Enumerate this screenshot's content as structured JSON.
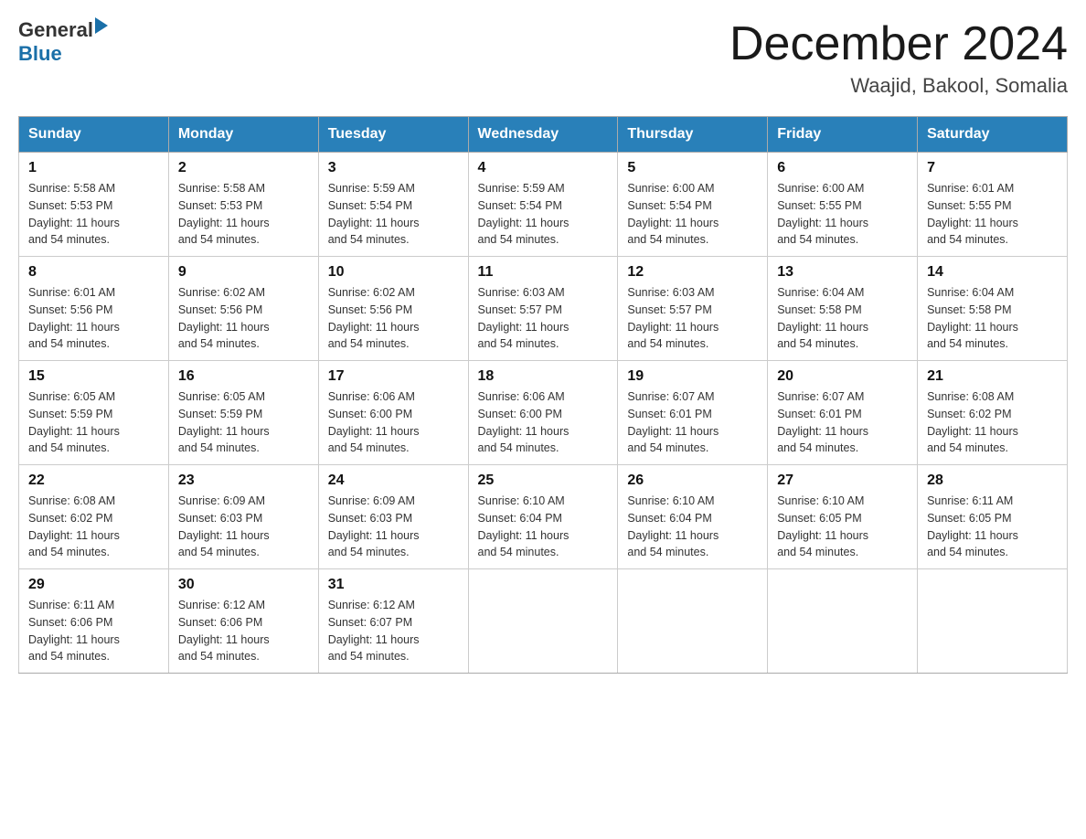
{
  "header": {
    "logo_general": "General",
    "logo_blue": "Blue",
    "month_title": "December 2024",
    "location": "Waajid, Bakool, Somalia"
  },
  "days_of_week": [
    "Sunday",
    "Monday",
    "Tuesday",
    "Wednesday",
    "Thursday",
    "Friday",
    "Saturday"
  ],
  "weeks": [
    [
      {
        "day": "1",
        "sunrise": "5:58 AM",
        "sunset": "5:53 PM",
        "daylight": "11 hours and 54 minutes."
      },
      {
        "day": "2",
        "sunrise": "5:58 AM",
        "sunset": "5:53 PM",
        "daylight": "11 hours and 54 minutes."
      },
      {
        "day": "3",
        "sunrise": "5:59 AM",
        "sunset": "5:54 PM",
        "daylight": "11 hours and 54 minutes."
      },
      {
        "day": "4",
        "sunrise": "5:59 AM",
        "sunset": "5:54 PM",
        "daylight": "11 hours and 54 minutes."
      },
      {
        "day": "5",
        "sunrise": "6:00 AM",
        "sunset": "5:54 PM",
        "daylight": "11 hours and 54 minutes."
      },
      {
        "day": "6",
        "sunrise": "6:00 AM",
        "sunset": "5:55 PM",
        "daylight": "11 hours and 54 minutes."
      },
      {
        "day": "7",
        "sunrise": "6:01 AM",
        "sunset": "5:55 PM",
        "daylight": "11 hours and 54 minutes."
      }
    ],
    [
      {
        "day": "8",
        "sunrise": "6:01 AM",
        "sunset": "5:56 PM",
        "daylight": "11 hours and 54 minutes."
      },
      {
        "day": "9",
        "sunrise": "6:02 AM",
        "sunset": "5:56 PM",
        "daylight": "11 hours and 54 minutes."
      },
      {
        "day": "10",
        "sunrise": "6:02 AM",
        "sunset": "5:56 PM",
        "daylight": "11 hours and 54 minutes."
      },
      {
        "day": "11",
        "sunrise": "6:03 AM",
        "sunset": "5:57 PM",
        "daylight": "11 hours and 54 minutes."
      },
      {
        "day": "12",
        "sunrise": "6:03 AM",
        "sunset": "5:57 PM",
        "daylight": "11 hours and 54 minutes."
      },
      {
        "day": "13",
        "sunrise": "6:04 AM",
        "sunset": "5:58 PM",
        "daylight": "11 hours and 54 minutes."
      },
      {
        "day": "14",
        "sunrise": "6:04 AM",
        "sunset": "5:58 PM",
        "daylight": "11 hours and 54 minutes."
      }
    ],
    [
      {
        "day": "15",
        "sunrise": "6:05 AM",
        "sunset": "5:59 PM",
        "daylight": "11 hours and 54 minutes."
      },
      {
        "day": "16",
        "sunrise": "6:05 AM",
        "sunset": "5:59 PM",
        "daylight": "11 hours and 54 minutes."
      },
      {
        "day": "17",
        "sunrise": "6:06 AM",
        "sunset": "6:00 PM",
        "daylight": "11 hours and 54 minutes."
      },
      {
        "day": "18",
        "sunrise": "6:06 AM",
        "sunset": "6:00 PM",
        "daylight": "11 hours and 54 minutes."
      },
      {
        "day": "19",
        "sunrise": "6:07 AM",
        "sunset": "6:01 PM",
        "daylight": "11 hours and 54 minutes."
      },
      {
        "day": "20",
        "sunrise": "6:07 AM",
        "sunset": "6:01 PM",
        "daylight": "11 hours and 54 minutes."
      },
      {
        "day": "21",
        "sunrise": "6:08 AM",
        "sunset": "6:02 PM",
        "daylight": "11 hours and 54 minutes."
      }
    ],
    [
      {
        "day": "22",
        "sunrise": "6:08 AM",
        "sunset": "6:02 PM",
        "daylight": "11 hours and 54 minutes."
      },
      {
        "day": "23",
        "sunrise": "6:09 AM",
        "sunset": "6:03 PM",
        "daylight": "11 hours and 54 minutes."
      },
      {
        "day": "24",
        "sunrise": "6:09 AM",
        "sunset": "6:03 PM",
        "daylight": "11 hours and 54 minutes."
      },
      {
        "day": "25",
        "sunrise": "6:10 AM",
        "sunset": "6:04 PM",
        "daylight": "11 hours and 54 minutes."
      },
      {
        "day": "26",
        "sunrise": "6:10 AM",
        "sunset": "6:04 PM",
        "daylight": "11 hours and 54 minutes."
      },
      {
        "day": "27",
        "sunrise": "6:10 AM",
        "sunset": "6:05 PM",
        "daylight": "11 hours and 54 minutes."
      },
      {
        "day": "28",
        "sunrise": "6:11 AM",
        "sunset": "6:05 PM",
        "daylight": "11 hours and 54 minutes."
      }
    ],
    [
      {
        "day": "29",
        "sunrise": "6:11 AM",
        "sunset": "6:06 PM",
        "daylight": "11 hours and 54 minutes."
      },
      {
        "day": "30",
        "sunrise": "6:12 AM",
        "sunset": "6:06 PM",
        "daylight": "11 hours and 54 minutes."
      },
      {
        "day": "31",
        "sunrise": "6:12 AM",
        "sunset": "6:07 PM",
        "daylight": "11 hours and 54 minutes."
      },
      null,
      null,
      null,
      null
    ]
  ],
  "labels": {
    "sunrise": "Sunrise:",
    "sunset": "Sunset:",
    "daylight": "Daylight:"
  }
}
